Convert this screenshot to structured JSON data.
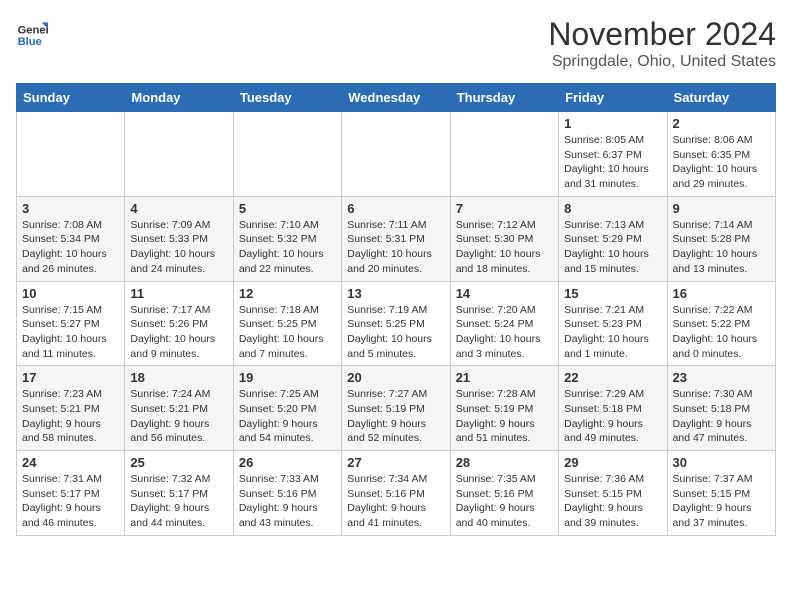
{
  "header": {
    "logo_general": "General",
    "logo_blue": "Blue",
    "month_title": "November 2024",
    "location": "Springdale, Ohio, United States"
  },
  "days_of_week": [
    "Sunday",
    "Monday",
    "Tuesday",
    "Wednesday",
    "Thursday",
    "Friday",
    "Saturday"
  ],
  "weeks": [
    [
      {
        "day": "",
        "info": ""
      },
      {
        "day": "",
        "info": ""
      },
      {
        "day": "",
        "info": ""
      },
      {
        "day": "",
        "info": ""
      },
      {
        "day": "",
        "info": ""
      },
      {
        "day": "1",
        "info": "Sunrise: 8:05 AM\nSunset: 6:37 PM\nDaylight: 10 hours\nand 31 minutes."
      },
      {
        "day": "2",
        "info": "Sunrise: 8:06 AM\nSunset: 6:35 PM\nDaylight: 10 hours\nand 29 minutes."
      }
    ],
    [
      {
        "day": "3",
        "info": "Sunrise: 7:08 AM\nSunset: 5:34 PM\nDaylight: 10 hours\nand 26 minutes."
      },
      {
        "day": "4",
        "info": "Sunrise: 7:09 AM\nSunset: 5:33 PM\nDaylight: 10 hours\nand 24 minutes."
      },
      {
        "day": "5",
        "info": "Sunrise: 7:10 AM\nSunset: 5:32 PM\nDaylight: 10 hours\nand 22 minutes."
      },
      {
        "day": "6",
        "info": "Sunrise: 7:11 AM\nSunset: 5:31 PM\nDaylight: 10 hours\nand 20 minutes."
      },
      {
        "day": "7",
        "info": "Sunrise: 7:12 AM\nSunset: 5:30 PM\nDaylight: 10 hours\nand 18 minutes."
      },
      {
        "day": "8",
        "info": "Sunrise: 7:13 AM\nSunset: 5:29 PM\nDaylight: 10 hours\nand 15 minutes."
      },
      {
        "day": "9",
        "info": "Sunrise: 7:14 AM\nSunset: 5:28 PM\nDaylight: 10 hours\nand 13 minutes."
      }
    ],
    [
      {
        "day": "10",
        "info": "Sunrise: 7:15 AM\nSunset: 5:27 PM\nDaylight: 10 hours\nand 11 minutes."
      },
      {
        "day": "11",
        "info": "Sunrise: 7:17 AM\nSunset: 5:26 PM\nDaylight: 10 hours\nand 9 minutes."
      },
      {
        "day": "12",
        "info": "Sunrise: 7:18 AM\nSunset: 5:25 PM\nDaylight: 10 hours\nand 7 minutes."
      },
      {
        "day": "13",
        "info": "Sunrise: 7:19 AM\nSunset: 5:25 PM\nDaylight: 10 hours\nand 5 minutes."
      },
      {
        "day": "14",
        "info": "Sunrise: 7:20 AM\nSunset: 5:24 PM\nDaylight: 10 hours\nand 3 minutes."
      },
      {
        "day": "15",
        "info": "Sunrise: 7:21 AM\nSunset: 5:23 PM\nDaylight: 10 hours\nand 1 minute."
      },
      {
        "day": "16",
        "info": "Sunrise: 7:22 AM\nSunset: 5:22 PM\nDaylight: 10 hours\nand 0 minutes."
      }
    ],
    [
      {
        "day": "17",
        "info": "Sunrise: 7:23 AM\nSunset: 5:21 PM\nDaylight: 9 hours\nand 58 minutes."
      },
      {
        "day": "18",
        "info": "Sunrise: 7:24 AM\nSunset: 5:21 PM\nDaylight: 9 hours\nand 56 minutes."
      },
      {
        "day": "19",
        "info": "Sunrise: 7:25 AM\nSunset: 5:20 PM\nDaylight: 9 hours\nand 54 minutes."
      },
      {
        "day": "20",
        "info": "Sunrise: 7:27 AM\nSunset: 5:19 PM\nDaylight: 9 hours\nand 52 minutes."
      },
      {
        "day": "21",
        "info": "Sunrise: 7:28 AM\nSunset: 5:19 PM\nDaylight: 9 hours\nand 51 minutes."
      },
      {
        "day": "22",
        "info": "Sunrise: 7:29 AM\nSunset: 5:18 PM\nDaylight: 9 hours\nand 49 minutes."
      },
      {
        "day": "23",
        "info": "Sunrise: 7:30 AM\nSunset: 5:18 PM\nDaylight: 9 hours\nand 47 minutes."
      }
    ],
    [
      {
        "day": "24",
        "info": "Sunrise: 7:31 AM\nSunset: 5:17 PM\nDaylight: 9 hours\nand 46 minutes."
      },
      {
        "day": "25",
        "info": "Sunrise: 7:32 AM\nSunset: 5:17 PM\nDaylight: 9 hours\nand 44 minutes."
      },
      {
        "day": "26",
        "info": "Sunrise: 7:33 AM\nSunset: 5:16 PM\nDaylight: 9 hours\nand 43 minutes."
      },
      {
        "day": "27",
        "info": "Sunrise: 7:34 AM\nSunset: 5:16 PM\nDaylight: 9 hours\nand 41 minutes."
      },
      {
        "day": "28",
        "info": "Sunrise: 7:35 AM\nSunset: 5:16 PM\nDaylight: 9 hours\nand 40 minutes."
      },
      {
        "day": "29",
        "info": "Sunrise: 7:36 AM\nSunset: 5:15 PM\nDaylight: 9 hours\nand 39 minutes."
      },
      {
        "day": "30",
        "info": "Sunrise: 7:37 AM\nSunset: 5:15 PM\nDaylight: 9 hours\nand 37 minutes."
      }
    ]
  ]
}
